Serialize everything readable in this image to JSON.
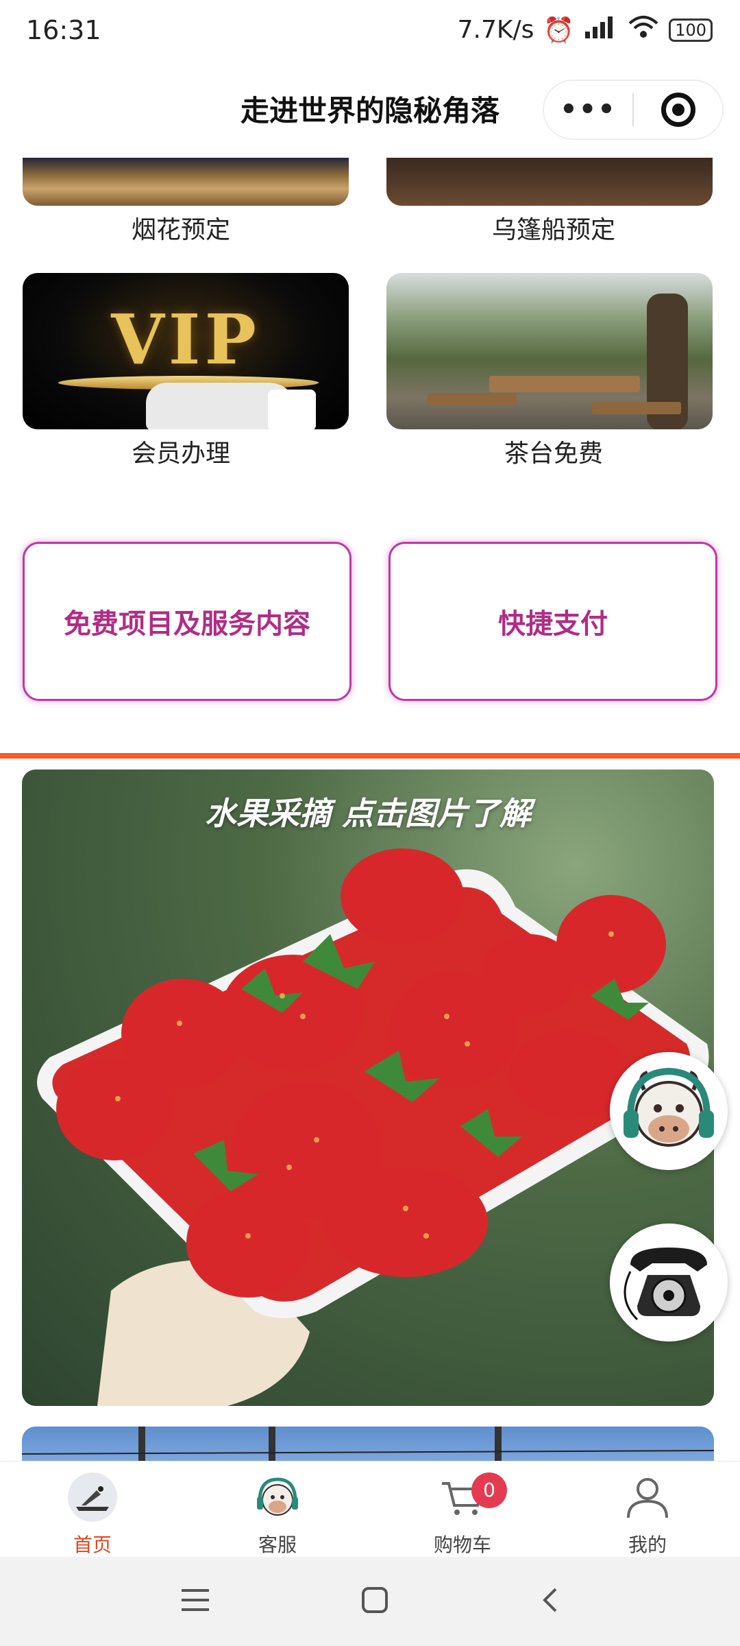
{
  "status_bar": {
    "time": "16:31",
    "network_speed": "7.7K/s",
    "battery": "100"
  },
  "header": {
    "title": "走进世界的隐秘角落",
    "more_label": "•••"
  },
  "grid_items": [
    {
      "label": "烟花预定"
    },
    {
      "label": "乌篷船预定"
    },
    {
      "label": "会员办理",
      "image_text": "VIP"
    },
    {
      "label": "茶台免费"
    }
  ],
  "buttons": {
    "free_services": "免费项目及服务内容",
    "quick_pay": "快捷支付"
  },
  "banner": {
    "title": "水果采摘 点击图片了解"
  },
  "tab_bar": {
    "tabs": [
      {
        "label": "首页",
        "icon": "home-icon"
      },
      {
        "label": "客服",
        "icon": "customer-service-icon"
      },
      {
        "label": "购物车",
        "icon": "cart-icon"
      },
      {
        "label": "我的",
        "icon": "user-icon"
      }
    ],
    "cart_count": "0"
  },
  "colors": {
    "accent": "#ff5a1f",
    "button_outline": "#c037a8",
    "button_text": "#b02c86",
    "badge": "#e53b50",
    "active_tab": "#e0451f"
  }
}
